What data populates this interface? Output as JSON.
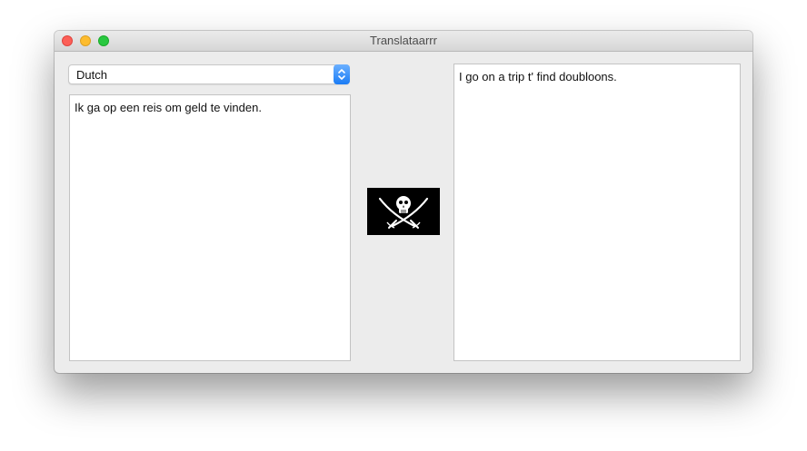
{
  "window": {
    "title": "Translataarrr"
  },
  "language_select": {
    "value": "Dutch"
  },
  "source_text": "Ik ga op een reis om geld te vinden.",
  "translated_text": "I go on a trip t' find doubloons.",
  "flag_icon": "jolly-roger-icon",
  "colors": {
    "window_bg": "#ececec",
    "accent_blue": "#1a7cf5",
    "close": "#fc5f57",
    "minimize": "#fdbc2e",
    "zoom": "#29c840"
  }
}
